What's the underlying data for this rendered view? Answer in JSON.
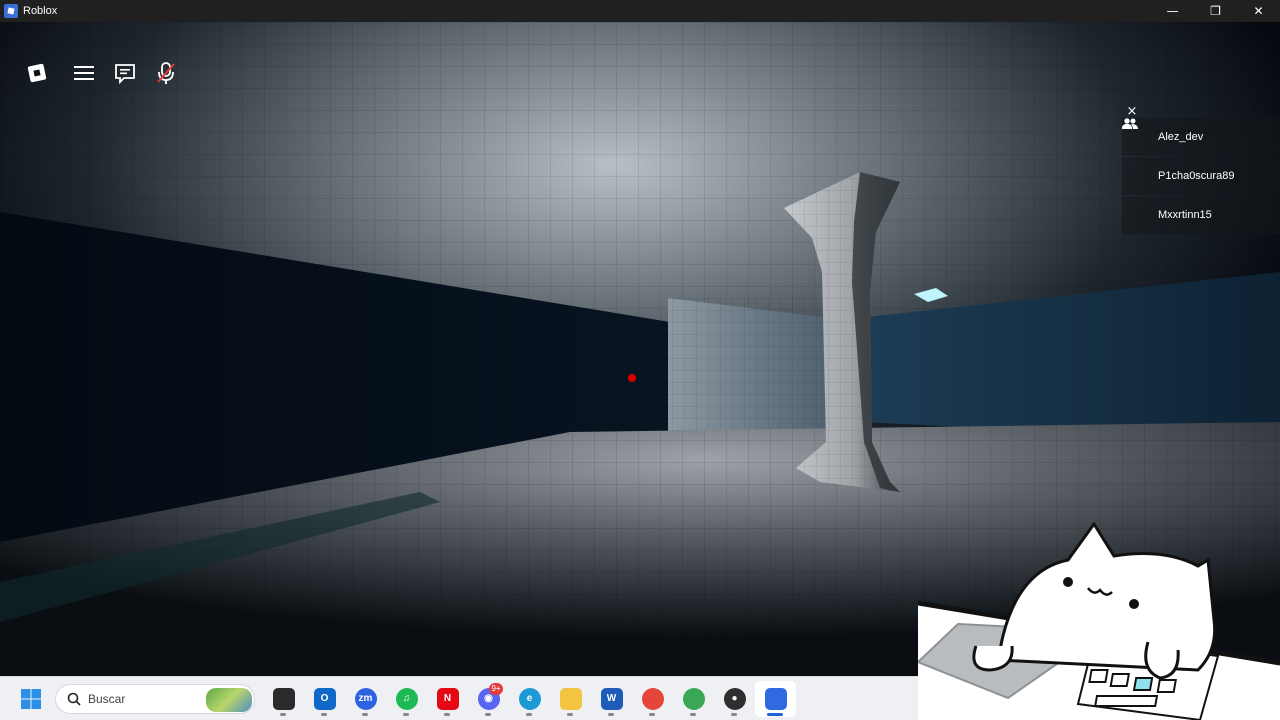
{
  "window": {
    "title": "Roblox",
    "controls": {
      "minimize": "—",
      "restore": "❐",
      "close": "✕"
    }
  },
  "hud": {
    "buttons": [
      {
        "name": "roblox-menu-icon"
      },
      {
        "name": "hamburger-icon"
      },
      {
        "name": "chat-icon"
      },
      {
        "name": "microphone-muted-icon"
      }
    ]
  },
  "playerlist": {
    "close_label": "×",
    "players": [
      {
        "name": "Alez_dev",
        "friend": true
      },
      {
        "name": "P1cha0scura89",
        "friend": false
      },
      {
        "name": "Mxxrtinn15",
        "friend": true
      }
    ]
  },
  "taskbar": {
    "search_placeholder": "Buscar",
    "apps": [
      {
        "name": "file-manager",
        "label": "",
        "color": "#2b2b2b"
      },
      {
        "name": "outlook",
        "label": "O",
        "color": "#1068c7"
      },
      {
        "name": "zoom",
        "label": "zm",
        "color": "#2d63e0"
      },
      {
        "name": "spotify",
        "label": "♫",
        "color": "#1db954"
      },
      {
        "name": "netflix",
        "label": "N",
        "color": "#e50914"
      },
      {
        "name": "discord",
        "label": "◉",
        "color": "#5865f2",
        "badge": "9+"
      },
      {
        "name": "edge",
        "label": "e",
        "color": "#1c9ad6"
      },
      {
        "name": "file-explorer",
        "label": "",
        "color": "#f3c342"
      },
      {
        "name": "word",
        "label": "W",
        "color": "#1f5bb8"
      },
      {
        "name": "chrome",
        "label": "",
        "color": "#e6453a"
      },
      {
        "name": "chrome-profile",
        "label": "",
        "color": "#3aa757"
      },
      {
        "name": "obs",
        "label": "●",
        "color": "#2e2e2e"
      },
      {
        "name": "roblox",
        "label": "",
        "color": "#2f6ae0",
        "active": true
      }
    ]
  },
  "colors": {
    "titlebar": "#202020",
    "taskbar": "#eef0f4",
    "friend_icon": "#ffffff",
    "red_dot": "#e00000"
  }
}
